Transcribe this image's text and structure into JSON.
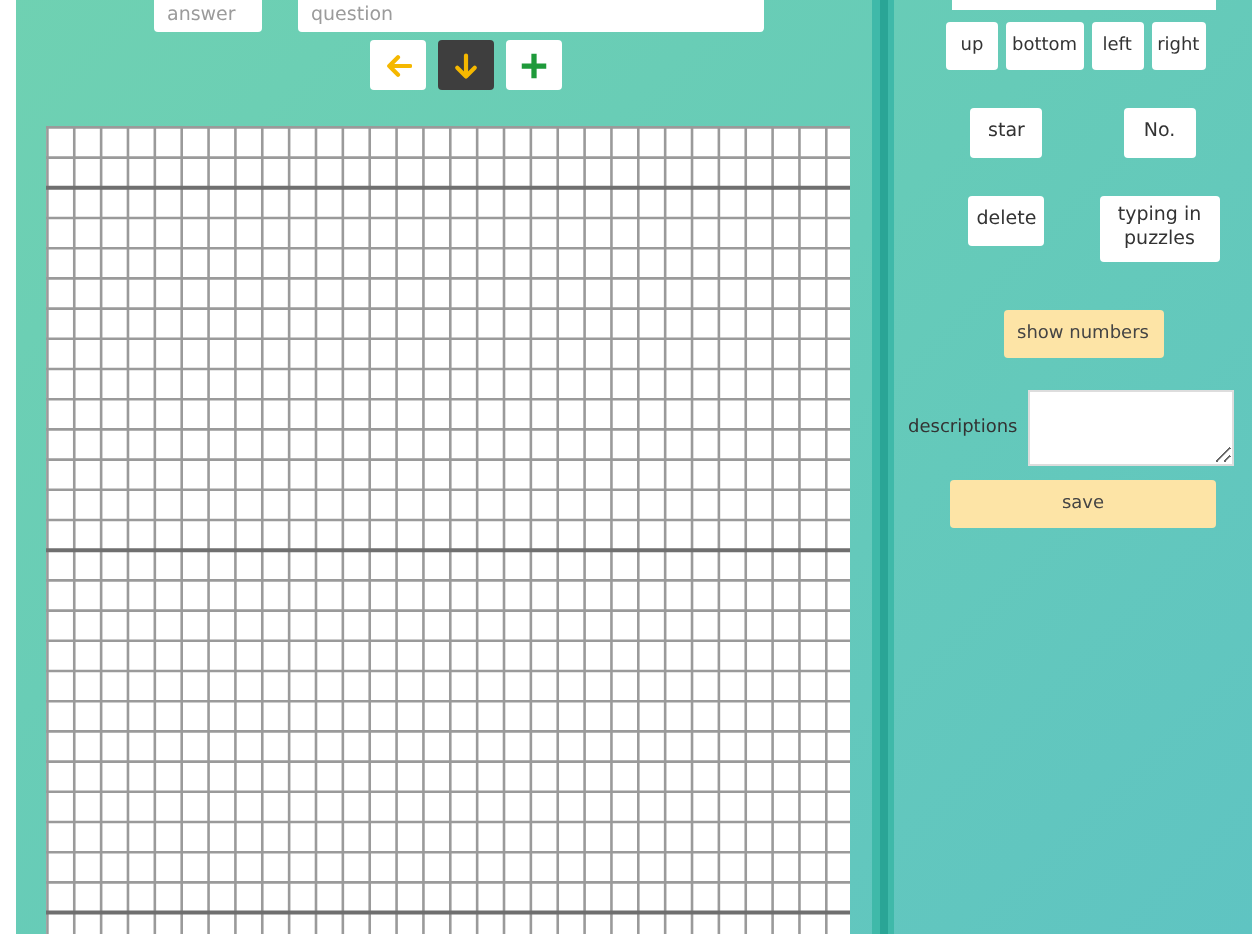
{
  "entry": {
    "answer": {
      "placeholder": "answer"
    },
    "question": {
      "placeholder": "question"
    }
  },
  "direction_buttons": [
    {
      "kind": "left",
      "selected": false
    },
    {
      "kind": "down",
      "selected": true
    },
    {
      "kind": "add",
      "selected": false
    }
  ],
  "side_panel": {
    "move_buttons": [
      "up",
      "bottom",
      "left",
      "right"
    ],
    "tool_buttons": [
      "star",
      "No.",
      "delete",
      "typing in puzzles"
    ],
    "show_numbers": "show numbers",
    "descriptions": {
      "label": "descriptions"
    },
    "save": "save"
  }
}
